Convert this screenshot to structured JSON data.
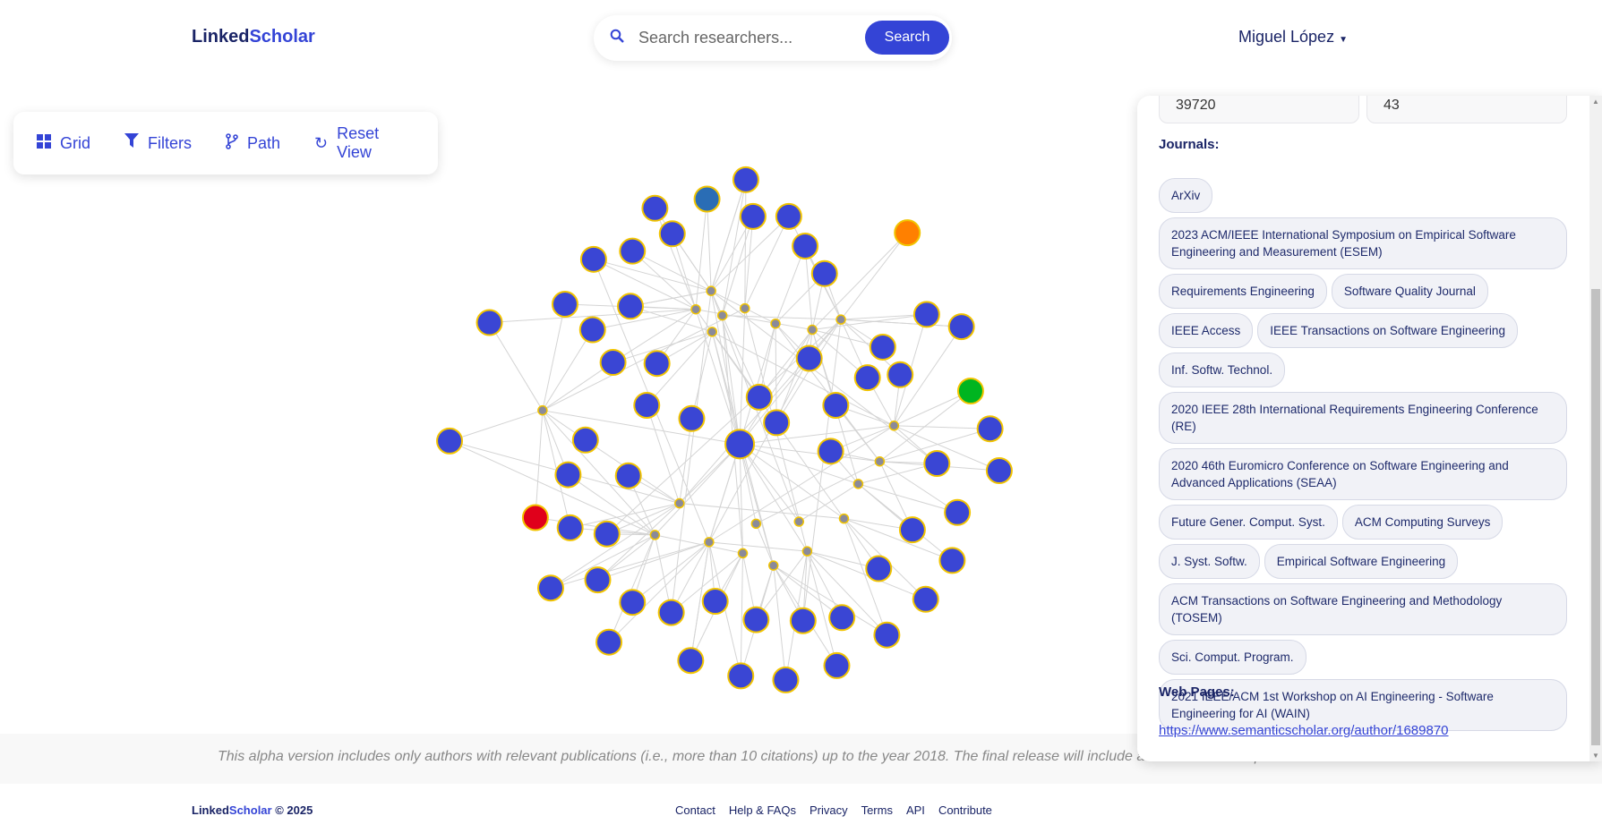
{
  "header": {
    "logo_a": "Linked",
    "logo_b": "Scholar",
    "search_placeholder": "Search researchers...",
    "search_button": "Search",
    "user": "Miguel López"
  },
  "toolbar": {
    "grid": "Grid",
    "filters": "Filters",
    "path": "Path",
    "reset": "Reset View"
  },
  "graph": {
    "node_color": "#3a46d4",
    "node_border": "#f2c400",
    "highlight_colors": [
      "#2a6db5",
      "#ff8000",
      "#00b520",
      "#e0001b"
    ]
  },
  "panel": {
    "stat_1": "39720",
    "stat_2": "43",
    "journals_label": "Journals:",
    "journals": [
      "ArXiv",
      "2023 ACM/IEEE International Symposium on Empirical Software Engineering and Measurement (ESEM)",
      "Requirements Engineering",
      "Software Quality Journal",
      "IEEE Access",
      "IEEE Transactions on Software Engineering",
      "Inf. Softw. Technol.",
      "2020 IEEE 28th International Requirements Engineering Conference (RE)",
      "2020 46th Euromicro Conference on Software Engineering and Advanced Applications (SEAA)",
      "Future Gener. Comput. Syst.",
      "ACM Computing Surveys",
      "J. Syst. Softw.",
      "Empirical Software Engineering",
      "ACM Transactions on Software Engineering and Methodology (TOSEM)",
      "Sci. Comput. Program.",
      "2021 IEEE/ACM 1st Workshop on AI Engineering - Software Engineering for AI (WAIN)"
    ],
    "web_label": "Web Pages:",
    "web_url": "https://www.semanticscholar.org/author/1689870"
  },
  "banner": "This alpha version includes only authors with relevant publications (i.e., more than 10 citations) up to the year 2018. The final release will include all research data up to date.",
  "footer": {
    "logo_a": "Linked",
    "logo_b": "Scholar",
    "copy": " © 2025",
    "links": [
      "Contact",
      "Help & FAQs",
      "Privacy",
      "Terms",
      "API",
      "Contribute"
    ]
  }
}
